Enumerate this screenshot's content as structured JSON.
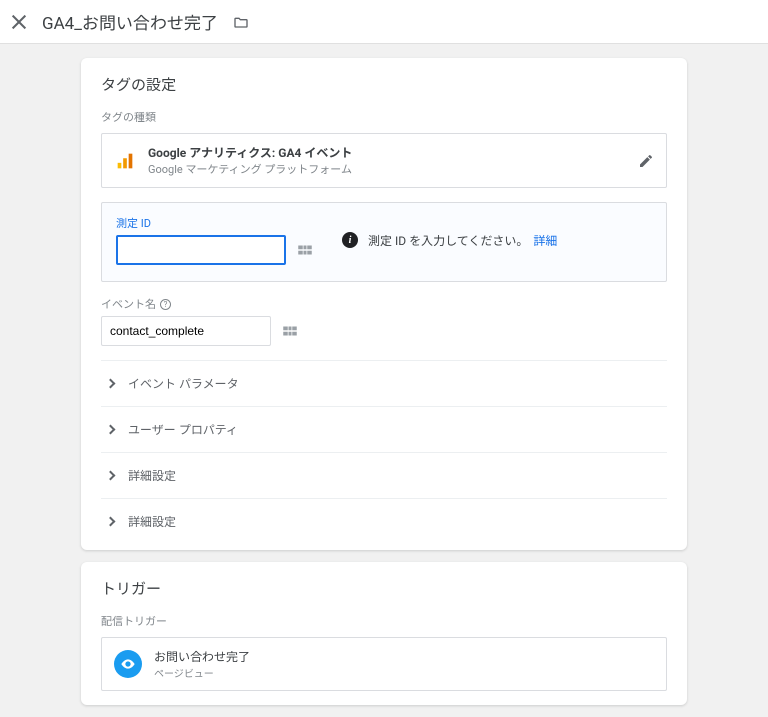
{
  "header": {
    "title": "GA4_お問い合わせ完了"
  },
  "tag": {
    "section_title": "タグの設定",
    "type_label": "タグの種類",
    "type_name": "Google アナリティクス: GA4 イベント",
    "type_sub": "Google マーケティング プラットフォーム",
    "measurement": {
      "label": "測定 ID",
      "value": "",
      "warn_text": "測定 ID を入力してください。",
      "warn_link": "詳細"
    },
    "event": {
      "label": "イベント名",
      "value": "contact_complete"
    },
    "expands": [
      "イベント パラメータ",
      "ユーザー プロパティ",
      "詳細設定",
      "詳細設定"
    ]
  },
  "trigger": {
    "section_title": "トリガー",
    "list_label": "配信トリガー",
    "items": [
      {
        "name": "お問い合わせ完了",
        "type": "ページビュー"
      }
    ]
  }
}
